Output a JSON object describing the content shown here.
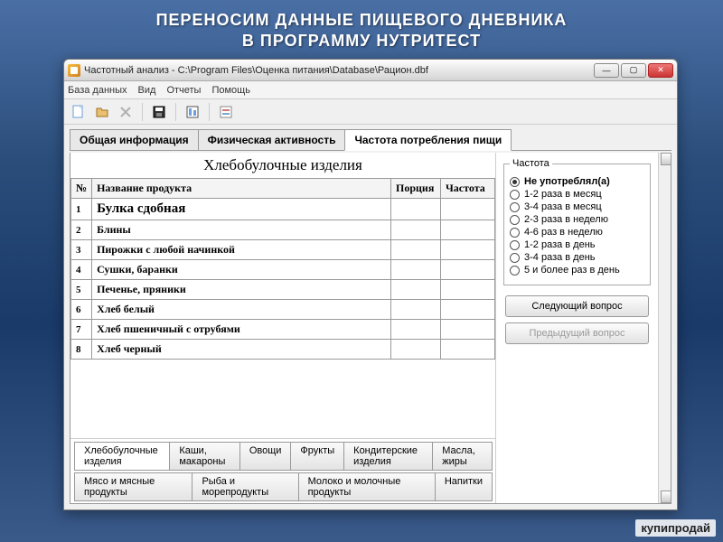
{
  "slide": {
    "line1": "ПЕРЕНОСИМ ДАННЫЕ ПИЩЕВОГО ДНЕВНИКА",
    "line2": "В ПРОГРАММУ НУТРИТЕСТ"
  },
  "window": {
    "title": "Частотный анализ - C:\\Program Files\\Оценка питания\\Database\\Рацион.dbf",
    "controls": {
      "min": "—",
      "max": "▢",
      "close": "✕"
    }
  },
  "menu": {
    "db": "База данных",
    "view": "Вид",
    "reports": "Отчеты",
    "help": "Помощь"
  },
  "tabs": {
    "general": "Общая информация",
    "activity": "Физическая активность",
    "freq": "Частота потребления пищи"
  },
  "section_title": "Хлебобулочные изделия",
  "columns": {
    "num": "№",
    "name": "Название продукта",
    "portion": "Порция",
    "freq": "Частота"
  },
  "products": [
    {
      "n": "1",
      "name": "Булка сдобная",
      "portion": "",
      "freq": "",
      "selected": true
    },
    {
      "n": "2",
      "name": "Блины",
      "portion": "",
      "freq": ""
    },
    {
      "n": "3",
      "name": "Пирожки с любой начинкой",
      "portion": "",
      "freq": ""
    },
    {
      "n": "4",
      "name": "Сушки, баранки",
      "portion": "",
      "freq": ""
    },
    {
      "n": "5",
      "name": "Печенье, пряники",
      "portion": "",
      "freq": ""
    },
    {
      "n": "6",
      "name": "Хлеб белый",
      "portion": "",
      "freq": ""
    },
    {
      "n": "7",
      "name": "Хлеб пшеничный с отрубями",
      "portion": "",
      "freq": ""
    },
    {
      "n": "8",
      "name": "Хлеб черный",
      "portion": "",
      "freq": ""
    }
  ],
  "freq_panel": {
    "legend": "Частота",
    "options": [
      "Не употреблял(а)",
      "1-2 раза в месяц",
      "3-4 раза в месяц",
      "2-3 раза в неделю",
      "4-6 раз в неделю",
      "1-2 раза в день",
      "3-4 раза в день",
      "5 и более раз в день"
    ],
    "selected_index": 0,
    "next": "Следующий вопрос",
    "prev": "Предыдущий вопрос"
  },
  "bottom_tabs_row1": [
    "Хлебобулочные изделия",
    "Каши, макароны",
    "Овощи",
    "Фрукты",
    "Кондитерские изделия",
    "Масла, жиры"
  ],
  "bottom_tabs_row2": [
    "Мясо и мясные продукты",
    "Рыба и морепродукты",
    "Молоко и молочные продукты",
    "Напитки"
  ],
  "watermark": "купипродай"
}
